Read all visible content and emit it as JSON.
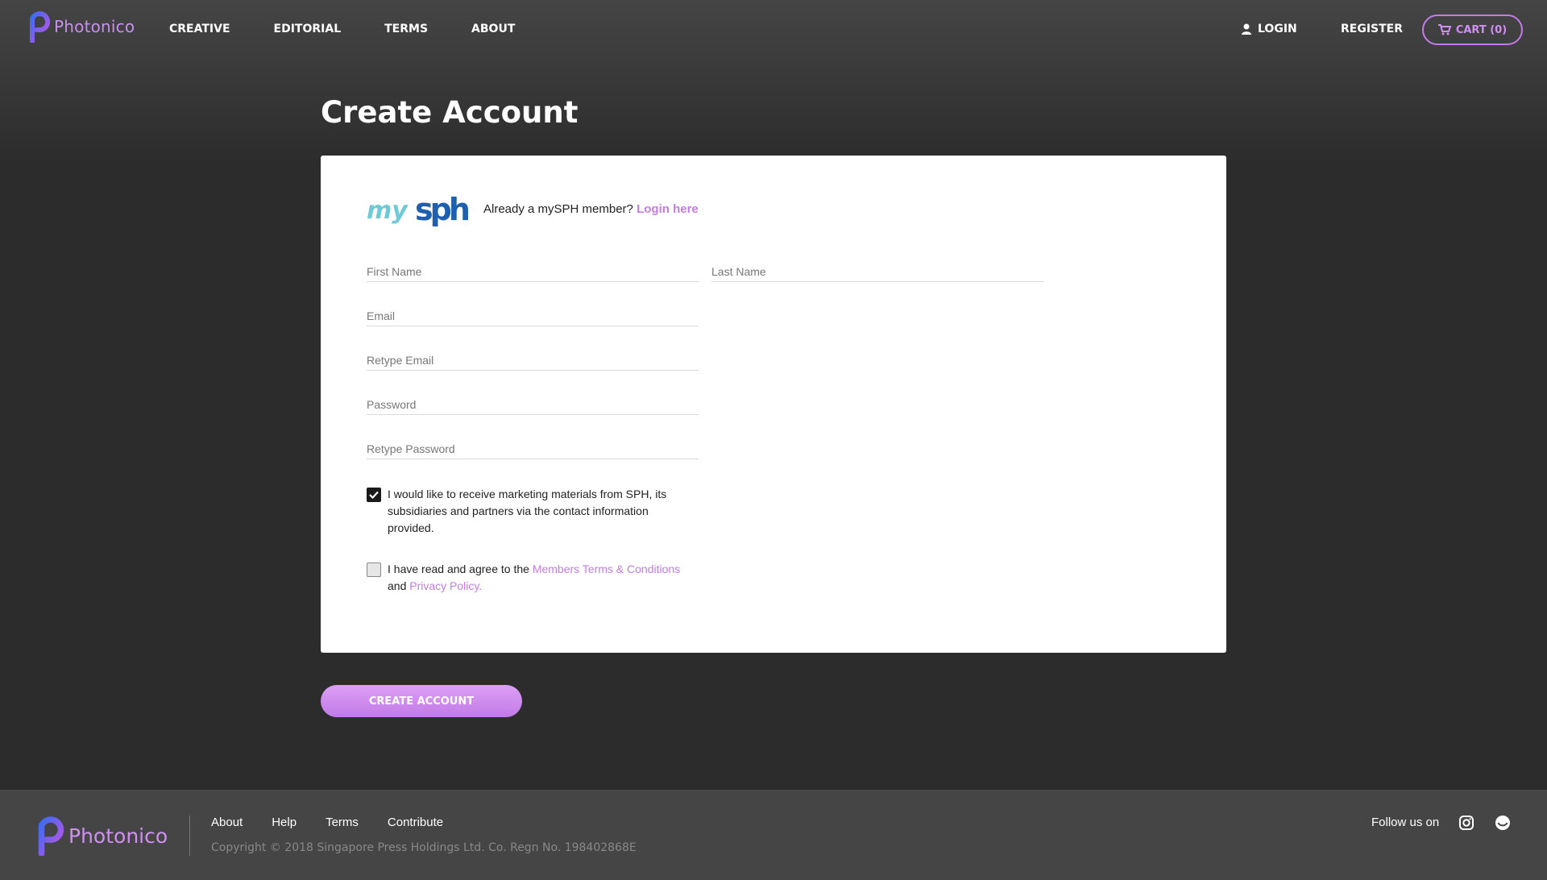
{
  "header": {
    "logo_text": "Photonico",
    "nav": [
      "CREATIVE",
      "EDITORIAL",
      "TERMS",
      "ABOUT"
    ],
    "login_label": "LOGIN",
    "register_label": "REGISTER",
    "cart_label": "CART (0)"
  },
  "page_title": "Create Account",
  "form": {
    "already_text": "Already a mySPH member?",
    "login_here": "Login here",
    "fields": {
      "first_name": "First Name",
      "last_name": "Last Name",
      "email": "Email",
      "retype_email": "Retype Email",
      "password": "Password",
      "retype_password": "Retype Password"
    },
    "marketing": {
      "checked": true,
      "text": "I would like to receive marketing materials from SPH, its subsidiaries and partners via the contact information provided."
    },
    "terms": {
      "checked": false,
      "prefix": "I have read and agree to the",
      "terms_link": "Members Terms & Conditions",
      "and": "and",
      "privacy_link": "Privacy Policy."
    },
    "submit_label": "CREATE ACCOUNT"
  },
  "footer": {
    "logo_text": "Photonico",
    "links": [
      "About",
      "Help",
      "Terms",
      "Contribute"
    ],
    "copyright": "Copyright © 2018 Singapore Press Holdings Ltd. Co. Regn No. 198402868E",
    "follow_text": "Follow us on"
  },
  "colors": {
    "accent": "#c47be8",
    "background": "#2d2c2d",
    "footer": "#454546"
  }
}
